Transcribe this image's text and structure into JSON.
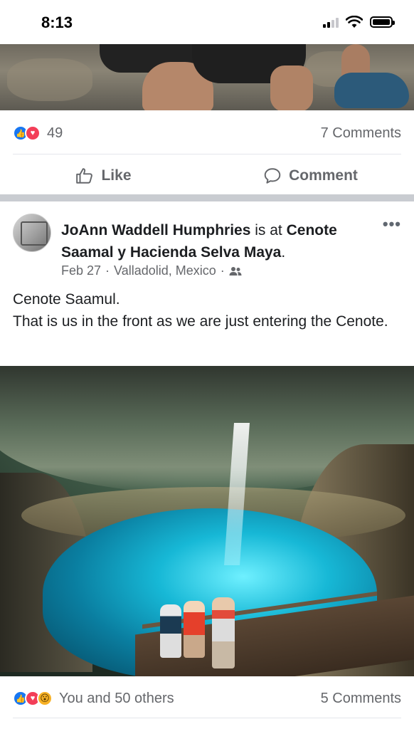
{
  "status_bar": {
    "time": "8:13"
  },
  "prev_post": {
    "reaction_count": "49",
    "comments": "7 Comments",
    "like_label": "Like",
    "comment_label": "Comment"
  },
  "post": {
    "author": "JoAnn Waddell Humphries",
    "connector": " is at ",
    "place": "Cenote Saamal y Hacienda Selva Maya",
    "place_suffix": ".",
    "date": "Feb 27",
    "location": "Valladolid, Mexico",
    "text_line1": "Cenote Saamul.",
    "text_line2": "That is us in the front as we are just entering the Cenote.",
    "reactions_text": "You and 50 others",
    "comments": "5 Comments"
  },
  "icons": {
    "reactions_prev": [
      "like",
      "love"
    ],
    "reactions_post": [
      "like",
      "love",
      "wow"
    ],
    "audience": "friends-icon",
    "more": "more-options-icon"
  },
  "colors": {
    "like_blue": "#1877f2",
    "love_red": "#f33e58",
    "wow_yellow": "#f7b125",
    "meta_gray": "#65676b"
  }
}
